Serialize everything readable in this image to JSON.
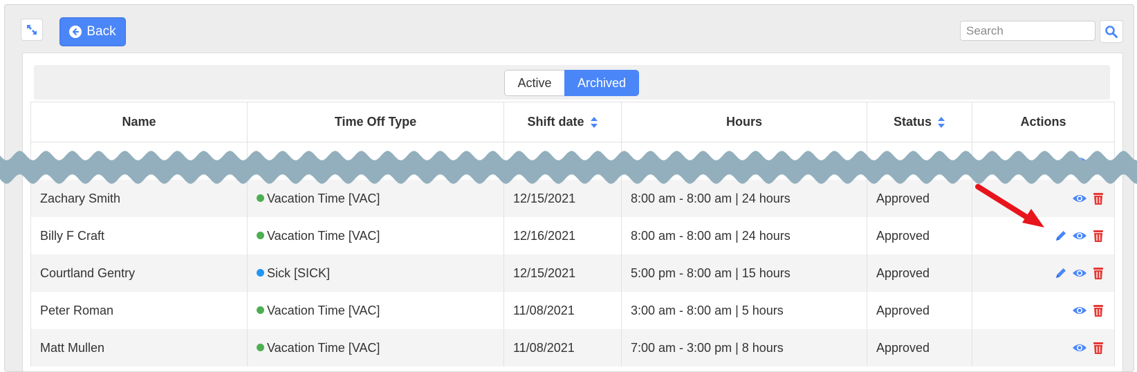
{
  "toolbar": {
    "back_label": "Back",
    "search_placeholder": "Search"
  },
  "toggle": {
    "active_label": "Active",
    "archived_label": "Archived",
    "selected": "Archived"
  },
  "table": {
    "headers": {
      "name": "Name",
      "type": "Time Off Type",
      "shift_date": "Shift date",
      "hours": "Hours",
      "status": "Status",
      "actions": "Actions"
    },
    "rows": [
      {
        "name": "",
        "type": "",
        "type_color": "#4caf50",
        "date": "",
        "hours": "",
        "status": "",
        "editable": false
      },
      {
        "name": "Zachary Smith",
        "type": "Vacation Time [VAC]",
        "type_color": "#4caf50",
        "date": "12/15/2021",
        "hours": "8:00 am - 8:00 am | 24 hours",
        "status": "Approved",
        "editable": false
      },
      {
        "name": "Billy F Craft",
        "type": "Vacation Time [VAC]",
        "type_color": "#4caf50",
        "date": "12/16/2021",
        "hours": "8:00 am - 8:00 am | 24 hours",
        "status": "Approved",
        "editable": true
      },
      {
        "name": "Courtland Gentry",
        "type": "Sick [SICK]",
        "type_color": "#2196f3",
        "date": "12/15/2021",
        "hours": "5:00 pm - 8:00 am | 15 hours",
        "status": "Approved",
        "editable": true
      },
      {
        "name": "Peter Roman",
        "type": "Vacation Time [VAC]",
        "type_color": "#4caf50",
        "date": "11/08/2021",
        "hours": "3:00 am - 8:00 am | 5 hours",
        "status": "Approved",
        "editable": false
      },
      {
        "name": "Matt Mullen",
        "type": "Vacation Time [VAC]",
        "type_color": "#4caf50",
        "date": "11/08/2021",
        "hours": "7:00 am - 3:00 pm | 8 hours",
        "status": "Approved",
        "editable": false
      }
    ]
  },
  "colors": {
    "primary": "#4a86f7",
    "delete": "#e53935",
    "annotation_arrow": "#e8141b",
    "tear": "#93afbd"
  },
  "icons": {
    "expand": "expand-arrows-icon",
    "back": "arrow-left-circle-icon",
    "search": "magnifier-icon",
    "sort": "sort-updown-icon",
    "edit": "pencil-icon",
    "view": "eye-icon",
    "delete": "trash-icon"
  }
}
